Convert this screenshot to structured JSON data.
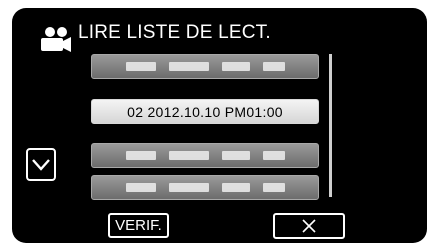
{
  "header": {
    "title": "LIRE LISTE DE LECT.",
    "mode_icon": "video-camera-icon"
  },
  "playlist": {
    "items": [
      {
        "label": "",
        "state": "empty"
      },
      {
        "label": "02  2012.10.10  PM01:00",
        "state": "filled"
      },
      {
        "label": "",
        "state": "empty"
      },
      {
        "label": "",
        "state": "empty"
      }
    ]
  },
  "controls": {
    "scroll_down_icon": "chevron-down-icon",
    "verify_label": "VERIF.",
    "close_icon": "close-icon"
  },
  "colors": {
    "background": "#000000",
    "foreground": "#ffffff",
    "item_filled": "#e6e6e6",
    "item_empty": "#808080"
  }
}
